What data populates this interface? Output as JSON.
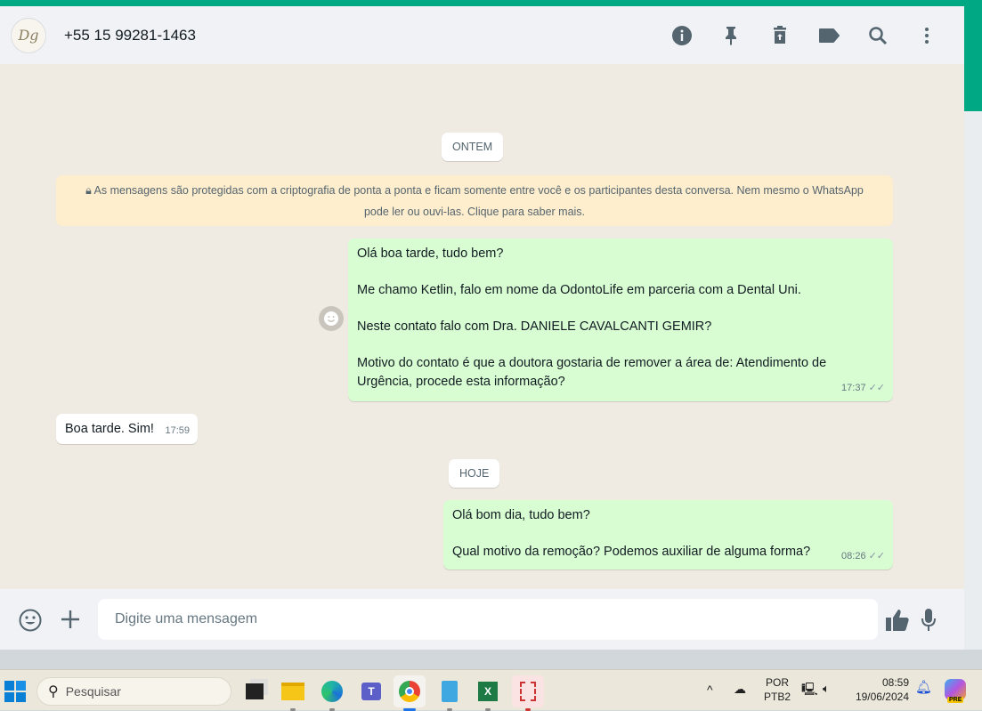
{
  "header": {
    "contact": "+55 15 99281-1463",
    "avatar_text": "Dg"
  },
  "chat": {
    "date_yesterday": "ONTEM",
    "encryption_notice": "As mensagens são protegidas com a criptografia de ponta a ponta e ficam somente entre você e os participantes desta conversa. Nem mesmo o WhatsApp pode ler ou ouvi-las. Clique para saber mais.",
    "messages": [
      {
        "direction": "out",
        "lines": [
          "Olá boa tarde, tudo bem?",
          "Me chamo Ketlin, falo em nome da OdontoLife em parceria com a Dental Uni.",
          "Neste contato falo com Dra. DANIELE CAVALCANTI GEMIR?",
          "Motivo do contato é que a doutora gostaria de remover a área de:  Atendimento de Urgência, procede esta informação?"
        ],
        "time": "17:37"
      },
      {
        "direction": "in",
        "lines": [
          "Boa tarde. Sim!"
        ],
        "time": "17:59"
      },
      {
        "direction": "out",
        "lines": [
          "Olá bom dia, tudo bem?",
          "Qual motivo da remoção? Podemos auxiliar de alguma forma?"
        ],
        "time": "08:26"
      }
    ],
    "date_today": "HOJE"
  },
  "composer": {
    "placeholder": "Digite uma mensagem"
  },
  "taskbar": {
    "search_label": "Pesquisar",
    "lang1": "POR",
    "lang2": "PTB2",
    "time": "08:59",
    "date": "19/06/2024",
    "copilot_badge": "PRE"
  },
  "colors": {
    "accent": "#00a884",
    "outgoing": "#d9fdd3",
    "notice": "#ffeecd"
  }
}
